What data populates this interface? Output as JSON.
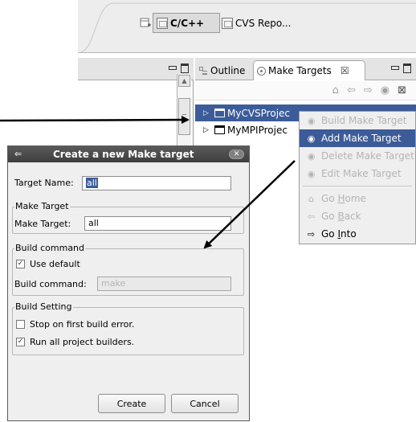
{
  "toolbar": {
    "perspective_cc_label": "C/C++",
    "perspective_cvs_label": "CVS Repo..."
  },
  "views": {
    "outline_tab_label": "Outline",
    "make_targets_tab_label": "Make Targets",
    "tab_close_glyph": "☒"
  },
  "tree": {
    "items": [
      {
        "label": "MyCVSProjec",
        "selected": true
      },
      {
        "label": "MyMPIProjec",
        "selected": false
      }
    ]
  },
  "context_menu": {
    "items": [
      {
        "label": "Build Make Target",
        "icon": "build-target-icon",
        "state": "disabled"
      },
      {
        "label": "Add Make Target",
        "icon": "add-target-icon",
        "state": "highlighted"
      },
      {
        "label": "Delete Make Target",
        "icon": "delete-target-icon",
        "state": "disabled"
      },
      {
        "label": "Edit Make Target",
        "icon": "edit-target-icon",
        "state": "disabled"
      },
      {
        "label": "Go Home",
        "icon": "home-icon",
        "state": "disabled"
      },
      {
        "label": "Go Back",
        "icon": "back-arrow-icon",
        "state": "disabled"
      },
      {
        "label": "Go Into",
        "icon": "forward-arrow-icon",
        "state": "enabled"
      }
    ]
  },
  "dialog": {
    "title": "Create a new Make target",
    "target_name_label": "Target Name:",
    "target_name_value": "all",
    "make_target_group": "Make Target",
    "make_target_label": "Make Target:",
    "make_target_value": "all",
    "build_command_group": "Build command",
    "use_default_label": "Use default",
    "use_default_checked": true,
    "build_command_label": "Build command:",
    "build_command_value": "make",
    "build_setting_group": "Build Setting",
    "stop_on_error_label": "Stop on first build error.",
    "stop_on_error_checked": false,
    "run_all_builders_label": "Run all project builders.",
    "run_all_builders_checked": true,
    "create_button": "Create",
    "cancel_button": "Cancel"
  },
  "colors": {
    "selection": "#3c5b99",
    "dialog_bg": "#efefef",
    "title_bar": "#4a4a4a"
  }
}
